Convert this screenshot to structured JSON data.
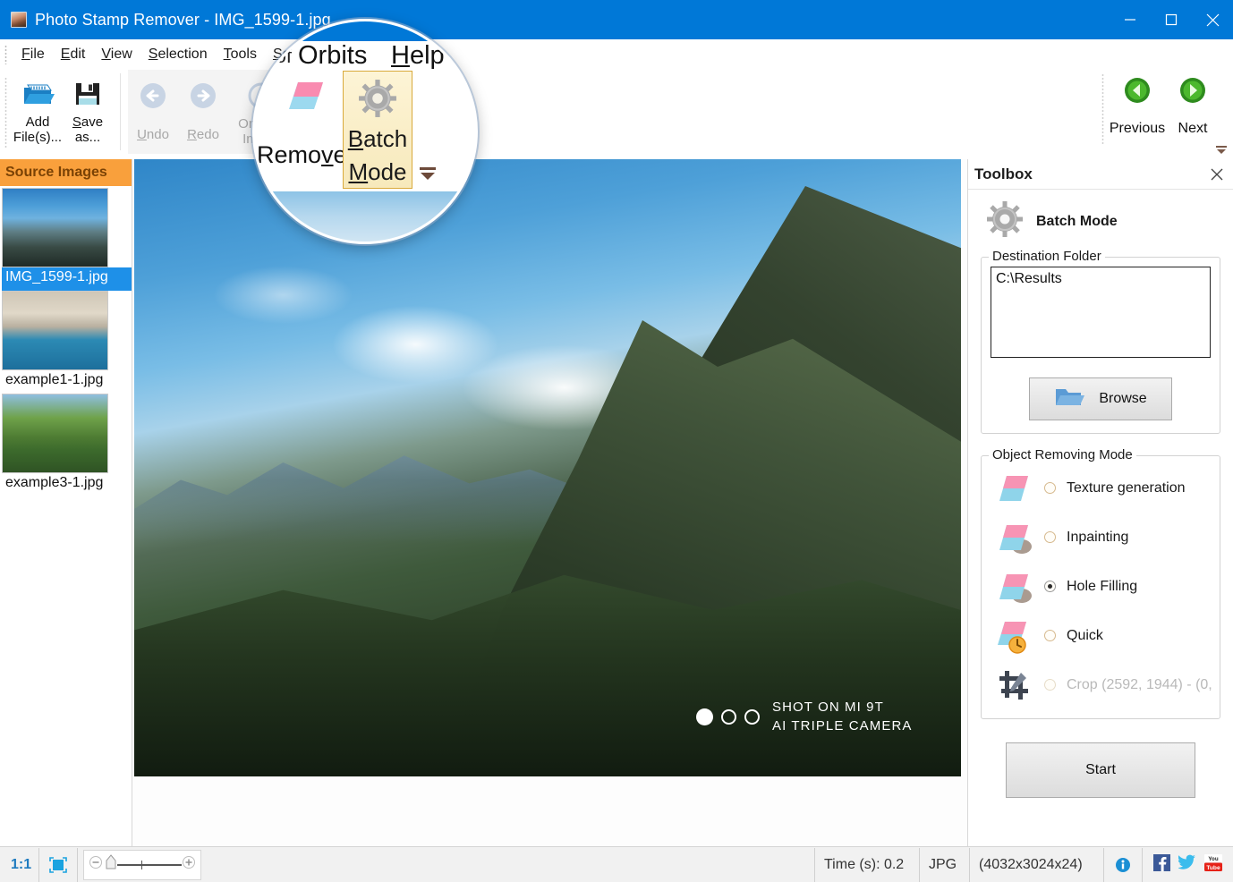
{
  "window": {
    "title": "Photo Stamp Remover - IMG_1599-1.jpg",
    "app_icon": "photo-icon",
    "minimize": "minimize-icon",
    "maximize": "maximize-icon",
    "close": "close-icon"
  },
  "menu": {
    "items": [
      {
        "pre": "",
        "accel": "F",
        "post": "ile"
      },
      {
        "pre": "",
        "accel": "E",
        "post": "dit"
      },
      {
        "pre": "",
        "accel": "V",
        "post": "iew"
      },
      {
        "pre": "",
        "accel": "S",
        "post": "election"
      },
      {
        "pre": "",
        "accel": "T",
        "post": "ools"
      },
      {
        "pre": "",
        "accel": "S",
        "post": "oftOrbits"
      },
      {
        "pre": "",
        "accel": "H",
        "post": "elp"
      }
    ]
  },
  "toolbar": {
    "add_files": {
      "line1": "Add",
      "line2": "File(s)...",
      "icon": "add-files-icon"
    },
    "save_as": {
      "line1_pre": "",
      "line1_accel": "S",
      "line1_post": "ave",
      "line2": "as...",
      "icon": "save-icon"
    },
    "undo": {
      "accel": "U",
      "post": "ndo",
      "icon": "undo-arrow-icon"
    },
    "redo": {
      "accel": "R",
      "post": "edo",
      "icon": "redo-arrow-icon"
    },
    "original_image": {
      "line1": "Original",
      "line2": "Image",
      "icon": "clock-history-icon"
    },
    "previous": {
      "label": "Previous",
      "icon": "previous-green-arrow-icon"
    },
    "next": {
      "label": "Next",
      "icon": "next-green-arrow-icon"
    },
    "overflow": "toolbar-overflow-icon"
  },
  "magnifier": {
    "menu_sof": "Sof",
    "menu_orbits": "Orbits",
    "menu_help_accel": "H",
    "menu_help_rest": "elp",
    "remove_pre": "Remo",
    "remove_accel": "v",
    "remove_post": "e",
    "batch_line1_accel": "B",
    "batch_line1_rest": "atch",
    "batch_line2_accel": "M",
    "batch_line2_rest": "ode",
    "gear_icon": "gear-icon",
    "eraser_icon": "eraser-icon",
    "dropdown_icon": "dropdown-arrow-icon"
  },
  "sidebar": {
    "header": "Source Images",
    "items": [
      {
        "label": "IMG_1599-1.jpg",
        "selected": true,
        "thumb": "mountain-thumbnail"
      },
      {
        "label": "example1-1.jpg",
        "selected": false,
        "thumb": "coastal-rocks-thumbnail"
      },
      {
        "label": "example3-1.jpg",
        "selected": false,
        "thumb": "fortress-garden-thumbnail"
      }
    ]
  },
  "canvas": {
    "watermark_line1": "SHOT ON MI 9T",
    "watermark_line2": "AI TRIPLE CAMERA",
    "watermark_dots": 3
  },
  "toolbox": {
    "title": "Toolbox",
    "close": "close-icon",
    "mode_title": "Batch Mode",
    "mode_icon": "gear-icon",
    "destination": {
      "legend": "Destination Folder",
      "value": "C:\\Results",
      "browse_label": "Browse",
      "browse_icon": "folder-icon"
    },
    "object_mode": {
      "legend": "Object Removing Mode",
      "options": [
        {
          "label": "Texture generation",
          "selected": false,
          "disabled": false,
          "icon": "eraser-icon"
        },
        {
          "label": "Inpainting",
          "selected": false,
          "disabled": false,
          "icon": "eraser-smudge-icon"
        },
        {
          "label": "Hole Filling",
          "selected": true,
          "disabled": false,
          "icon": "eraser-smudge-icon"
        },
        {
          "label": "Quick",
          "selected": false,
          "disabled": false,
          "icon": "eraser-clock-icon"
        },
        {
          "label": "Crop (2592, 1944) - (0,",
          "selected": false,
          "disabled": true,
          "icon": "crop-icon"
        }
      ]
    },
    "start": {
      "label": "Start",
      "icon": "green-play-arrow-icon"
    }
  },
  "statusbar": {
    "zoom_ratio": "1:1",
    "fit_icon": "fit-to-window-icon",
    "zoom_out_icon": "zoom-out-icon",
    "zoom_in_icon": "zoom-in-icon",
    "slider_handle": "zoom-slider-handle",
    "time": "Time (s): 0.2",
    "format": "JPG",
    "resolution": "(4032x3024x24)",
    "info_icon": "info-icon",
    "facebook_icon": "facebook-icon",
    "twitter_icon": "twitter-icon",
    "youtube_icon": "youtube-icon"
  },
  "colors": {
    "titlebar": "#0078d7",
    "sidebar_header": "#f9a03c",
    "selection": "#1e90e8",
    "highlight_button": "#fdf4d6",
    "green_accent": "#3a9e1f"
  }
}
